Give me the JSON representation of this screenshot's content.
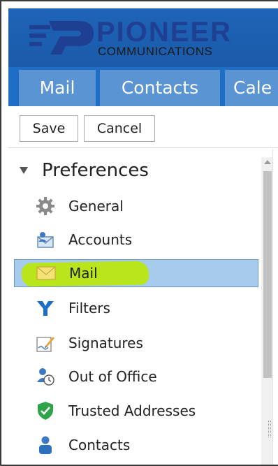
{
  "brand": {
    "title": "PIONEER",
    "subtitle": "COMMUNICATIONS",
    "colors": {
      "banner": "#1f64b8",
      "title": "#1e3f92"
    }
  },
  "tabs": [
    {
      "label": "Mail"
    },
    {
      "label": "Contacts"
    },
    {
      "label": "Cale"
    }
  ],
  "toolbar": {
    "save_label": "Save",
    "cancel_label": "Cancel"
  },
  "sidebar": {
    "header": "Preferences",
    "items": [
      {
        "label": "General",
        "icon": "gear-icon"
      },
      {
        "label": "Accounts",
        "icon": "accounts-icon"
      },
      {
        "label": "Mail",
        "icon": "envelope-icon",
        "selected": true
      },
      {
        "label": "Filters",
        "icon": "filter-icon"
      },
      {
        "label": "Signatures",
        "icon": "signature-icon"
      },
      {
        "label": "Out of Office",
        "icon": "out-of-office-icon"
      },
      {
        "label": "Trusted Addresses",
        "icon": "shield-check-icon"
      },
      {
        "label": "Contacts",
        "icon": "person-icon"
      }
    ],
    "selection_color": "#a6cbec",
    "highlight_color": "#b8e61a"
  }
}
